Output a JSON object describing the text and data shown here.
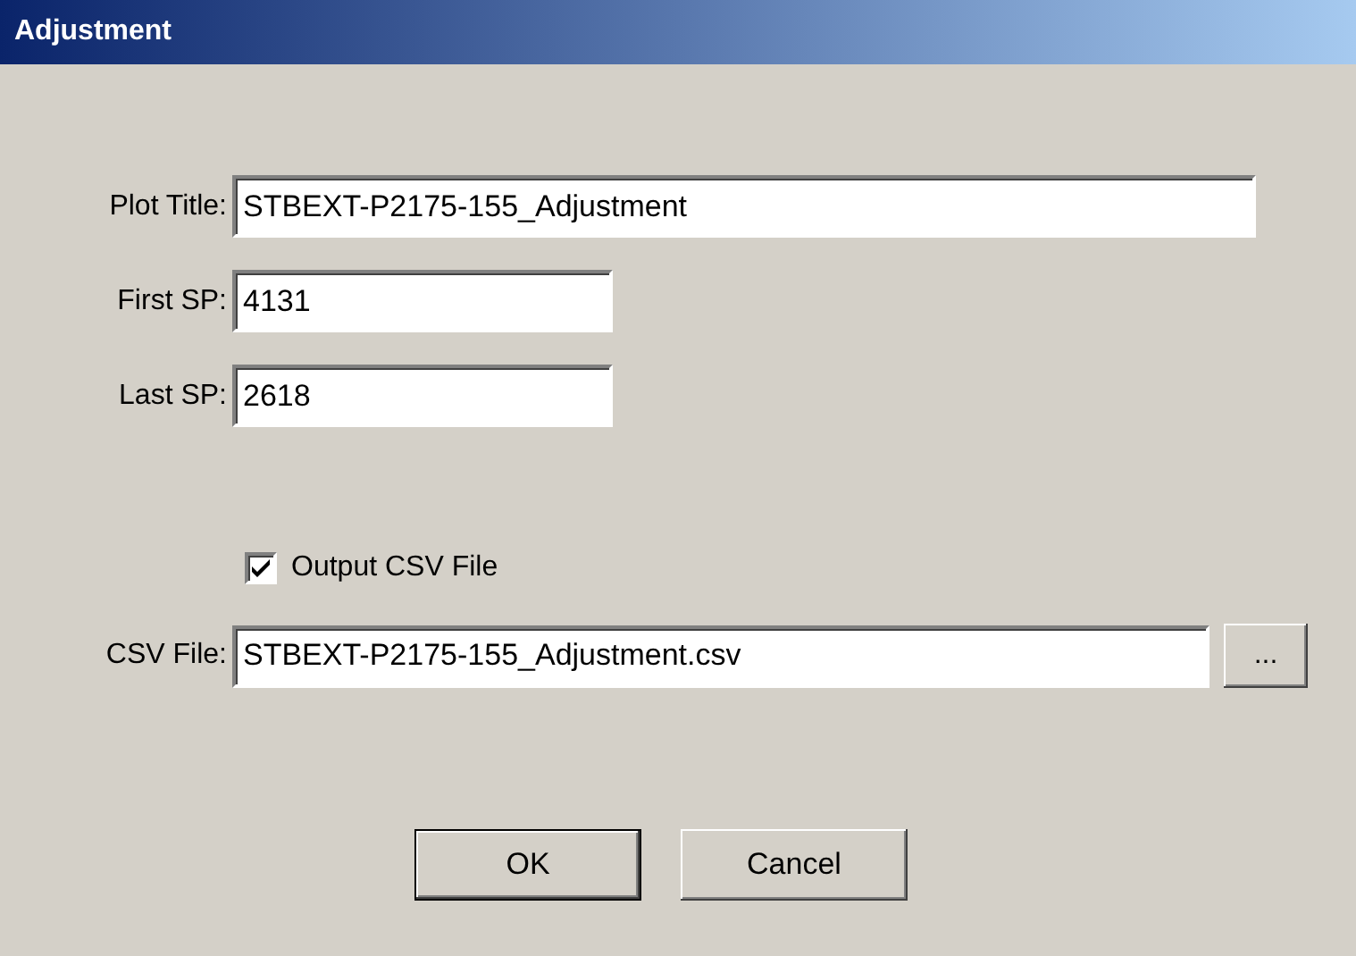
{
  "window": {
    "title": "Adjustment"
  },
  "fields": [
    {
      "label": "Plot Title:",
      "value": "STBEXT-P2175-155_Adjustment"
    },
    {
      "label": "First SP:",
      "value": "4131"
    },
    {
      "label": "Last SP:",
      "value": "2618"
    }
  ],
  "output_csv": {
    "label": "Output CSV File",
    "checked": true
  },
  "csv_file": {
    "label": "CSV File:",
    "value": "STBEXT-P2175-155_Adjustment.csv",
    "browse": "..."
  },
  "buttons": [
    {
      "label": "OK",
      "default": true
    },
    {
      "label": "Cancel",
      "default": false
    }
  ]
}
